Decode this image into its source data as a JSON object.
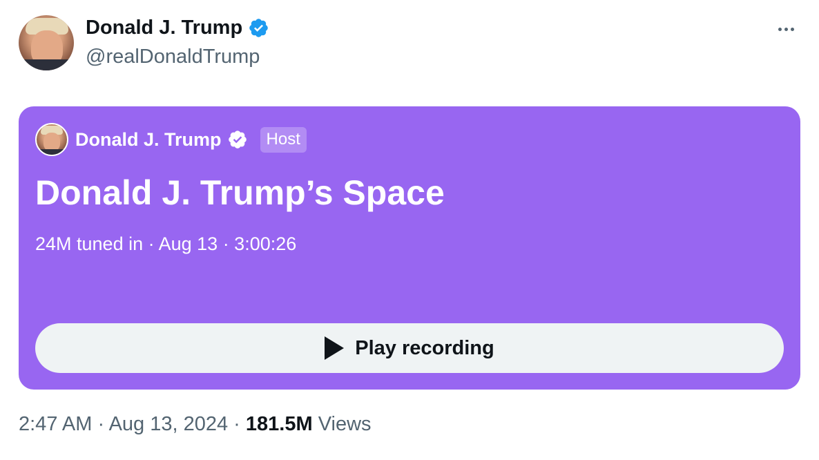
{
  "author": {
    "name": "Donald J. Trump",
    "handle": "@realDonaldTrump",
    "verified_color": "#1d9bf0"
  },
  "space": {
    "host_name": "Donald J. Trump",
    "host_badge": "Host",
    "title": "Donald J. Trump’s Space",
    "meta": "24M tuned in · Aug 13 · 3:00:26",
    "play_label": "Play recording",
    "card_color": "#9866f1"
  },
  "footer": {
    "time_date": "2:47 AM · Aug 13, 2024 · ",
    "views_count": "181.5M",
    "views_label": "Views"
  },
  "icons": {
    "more": "more-horizontal-icon",
    "verified": "verified-badge-icon",
    "play": "play-icon"
  }
}
